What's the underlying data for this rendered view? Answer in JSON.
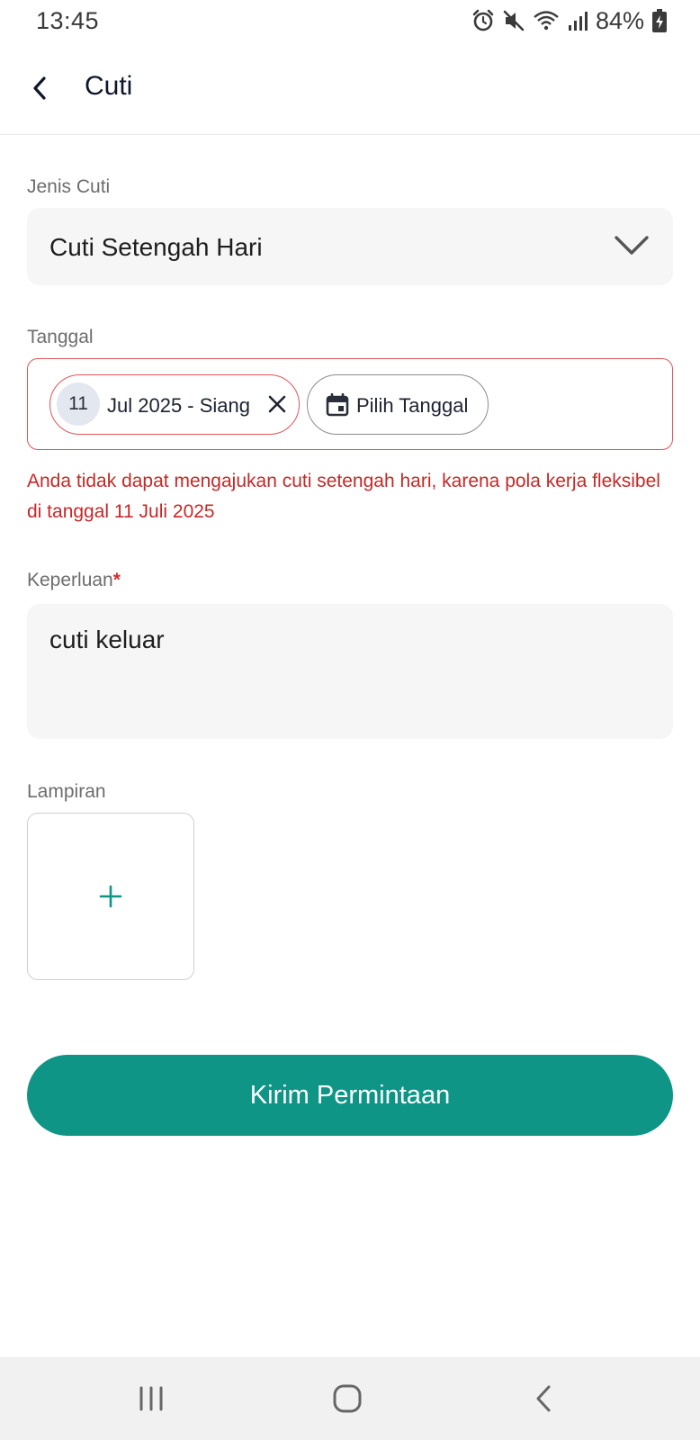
{
  "status_bar": {
    "time": "13:45",
    "battery": "84%",
    "icons": [
      "alarm-icon",
      "mute-icon",
      "wifi-icon",
      "signal-icon",
      "battery-charging-icon"
    ]
  },
  "app_bar": {
    "title": "Cuti",
    "back_icon": "back-arrow-icon"
  },
  "form": {
    "leave_type": {
      "label": "Jenis Cuti",
      "value": "Cuti Setengah Hari",
      "icon": "chevron-down-icon"
    },
    "date": {
      "label": "Tanggal",
      "selected_chip": {
        "day": "11",
        "text": "Jul 2025 - Siang"
      },
      "pick_button_label": "Pilih Tanggal",
      "error": "Anda tidak dapat mengajukan cuti setengah hari, karena pola kerja fleksibel di tanggal 11 Juli 2025"
    },
    "purpose": {
      "label": "Keperluan",
      "required_mark": "*",
      "value": "cuti keluar"
    },
    "attachment": {
      "label": "Lampiran",
      "icon": "plus-icon"
    },
    "submit_label": "Kirim Permintaan"
  },
  "nav_bar": {
    "icons": [
      "recent-apps-icon",
      "home-icon",
      "back-icon"
    ]
  },
  "colors": {
    "primary": "#0e9586",
    "error": "#c62828",
    "error_border": "#e0545a",
    "field_bg": "#f6f6f6"
  }
}
